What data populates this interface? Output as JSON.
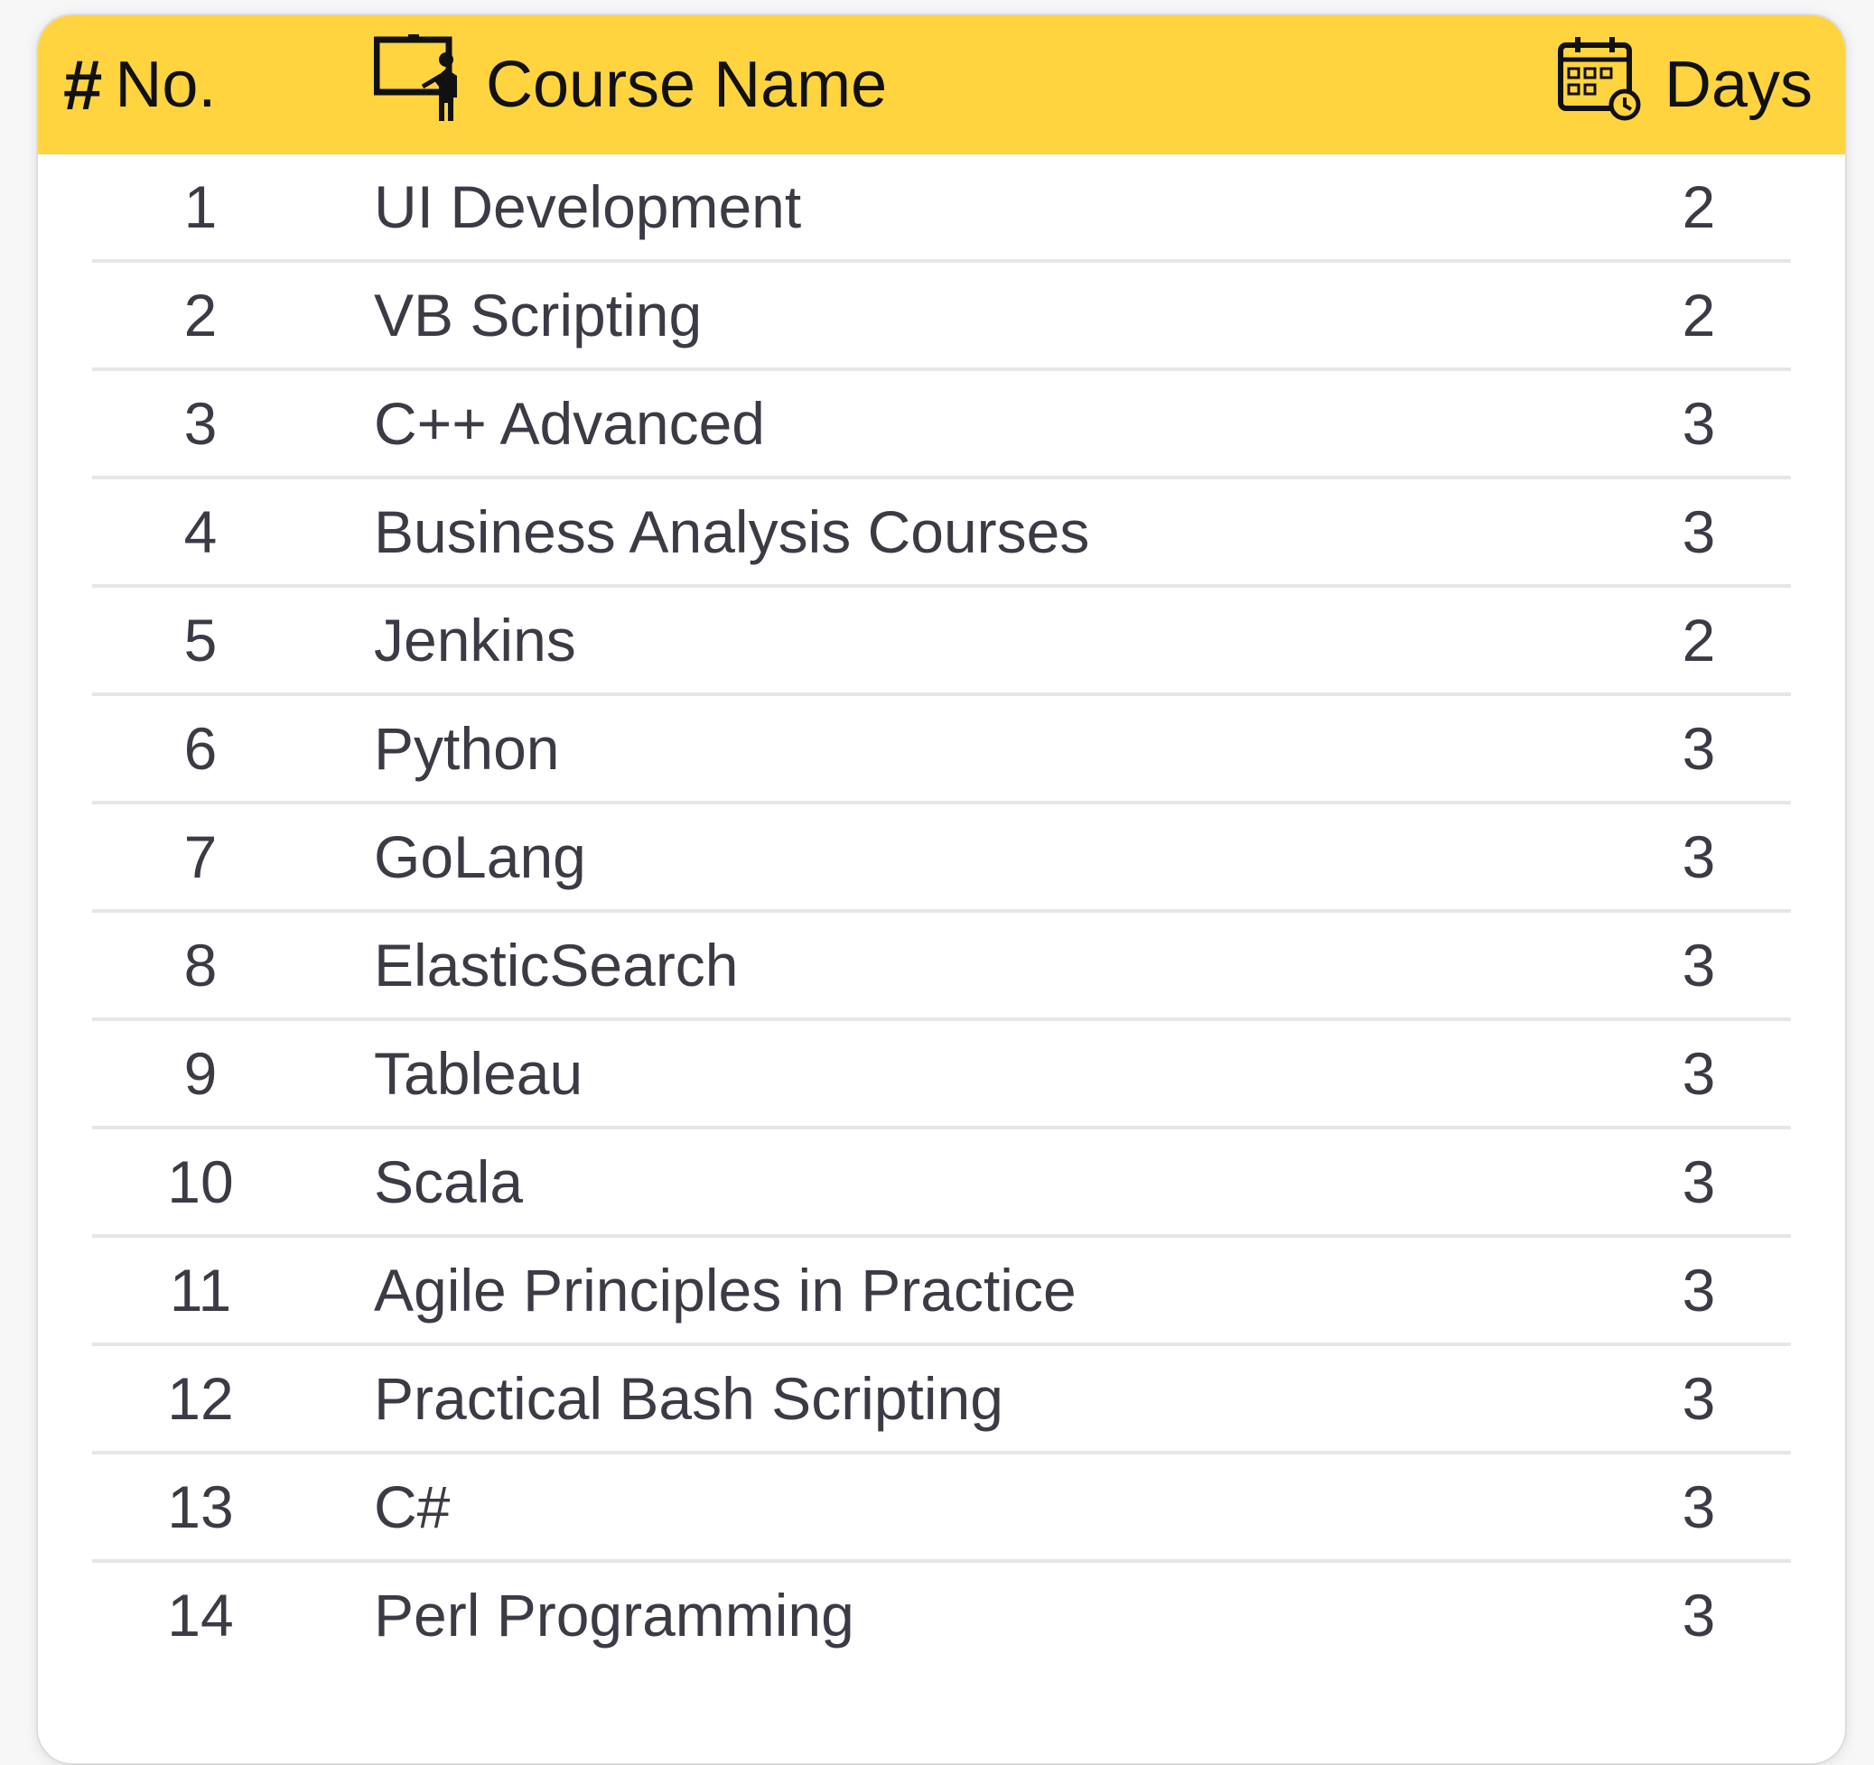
{
  "table": {
    "headers": {
      "number_symbol": "#",
      "number": "No.",
      "course": "Course Name",
      "days": "Days"
    },
    "header_icons": {
      "course": "presenter-board-icon",
      "days": "calendar-clock-icon"
    },
    "rows": [
      {
        "no": "1",
        "course": "UI Development",
        "days": "2"
      },
      {
        "no": "2",
        "course": "VB Scripting",
        "days": "2"
      },
      {
        "no": "3",
        "course": "C++ Advanced",
        "days": "3"
      },
      {
        "no": "4",
        "course": "Business Analysis Courses",
        "days": "3"
      },
      {
        "no": "5",
        "course": "Jenkins",
        "days": "2"
      },
      {
        "no": "6",
        "course": "Python",
        "days": "3"
      },
      {
        "no": "7",
        "course": "GoLang",
        "days": "3"
      },
      {
        "no": "8",
        "course": "ElasticSearch",
        "days": "3"
      },
      {
        "no": "9",
        "course": "Tableau",
        "days": "3"
      },
      {
        "no": "10",
        "course": "Scala",
        "days": "3"
      },
      {
        "no": "11",
        "course": "Agile Principles in Practice",
        "days": "3"
      },
      {
        "no": "12",
        "course": "Practical Bash Scripting",
        "days": "3"
      },
      {
        "no": "13",
        "course": "C#",
        "days": "3"
      },
      {
        "no": "14",
        "course": "Perl Programming",
        "days": "3"
      }
    ]
  },
  "colors": {
    "header_bg": "#ffd43f",
    "header_text": "#111111",
    "row_text": "#3b3b46",
    "separator": "#e6e6e6"
  }
}
